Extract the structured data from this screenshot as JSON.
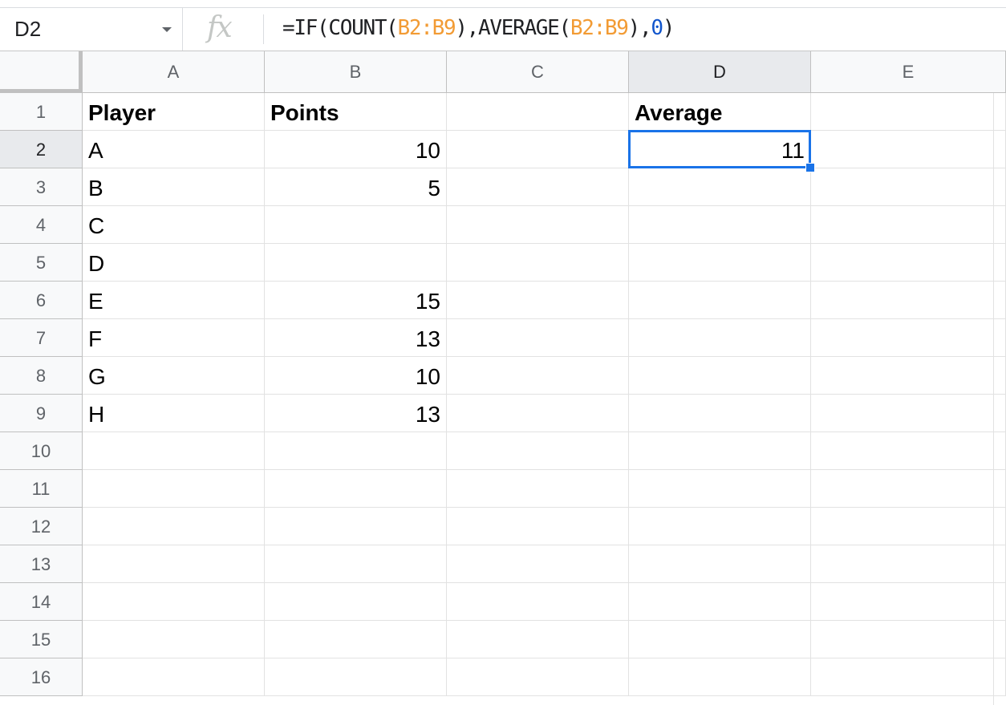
{
  "formula_bar": {
    "name_box": "D2",
    "fx_label": "fx",
    "formula_tokens": [
      {
        "text": "=IF(COUNT(",
        "kind": "fn"
      },
      {
        "text": "B2:B9",
        "kind": "ref"
      },
      {
        "text": "),AVERAGE(",
        "kind": "fn"
      },
      {
        "text": "B2:B9",
        "kind": "ref"
      },
      {
        "text": "),",
        "kind": "fn"
      },
      {
        "text": "0",
        "kind": "num"
      },
      {
        "text": ")",
        "kind": "fn"
      }
    ]
  },
  "colors": {
    "accent": "#1a73e8",
    "range_ref": "#f29b34",
    "number_literal": "#1155cc"
  },
  "sheet": {
    "columns": [
      "A",
      "B",
      "C",
      "D",
      "E"
    ],
    "rows": [
      "1",
      "2",
      "3",
      "4",
      "5",
      "6",
      "7",
      "8",
      "9",
      "10",
      "11",
      "12",
      "13",
      "14",
      "15",
      "16"
    ],
    "active_cell": "D2",
    "cells": {
      "A1": {
        "value": "Player",
        "bold": true
      },
      "B1": {
        "value": "Points",
        "bold": true
      },
      "D1": {
        "value": "Average",
        "bold": true
      },
      "A2": {
        "value": "A"
      },
      "B2": {
        "value": "10",
        "numeric": true
      },
      "D2": {
        "value": "11",
        "numeric": true
      },
      "A3": {
        "value": "B"
      },
      "B3": {
        "value": "5",
        "numeric": true
      },
      "A4": {
        "value": "C"
      },
      "A5": {
        "value": "D"
      },
      "A6": {
        "value": "E"
      },
      "B6": {
        "value": "15",
        "numeric": true
      },
      "A7": {
        "value": "F"
      },
      "B7": {
        "value": "13",
        "numeric": true
      },
      "A8": {
        "value": "G"
      },
      "B8": {
        "value": "10",
        "numeric": true
      },
      "A9": {
        "value": "H"
      },
      "B9": {
        "value": "13",
        "numeric": true
      }
    }
  }
}
